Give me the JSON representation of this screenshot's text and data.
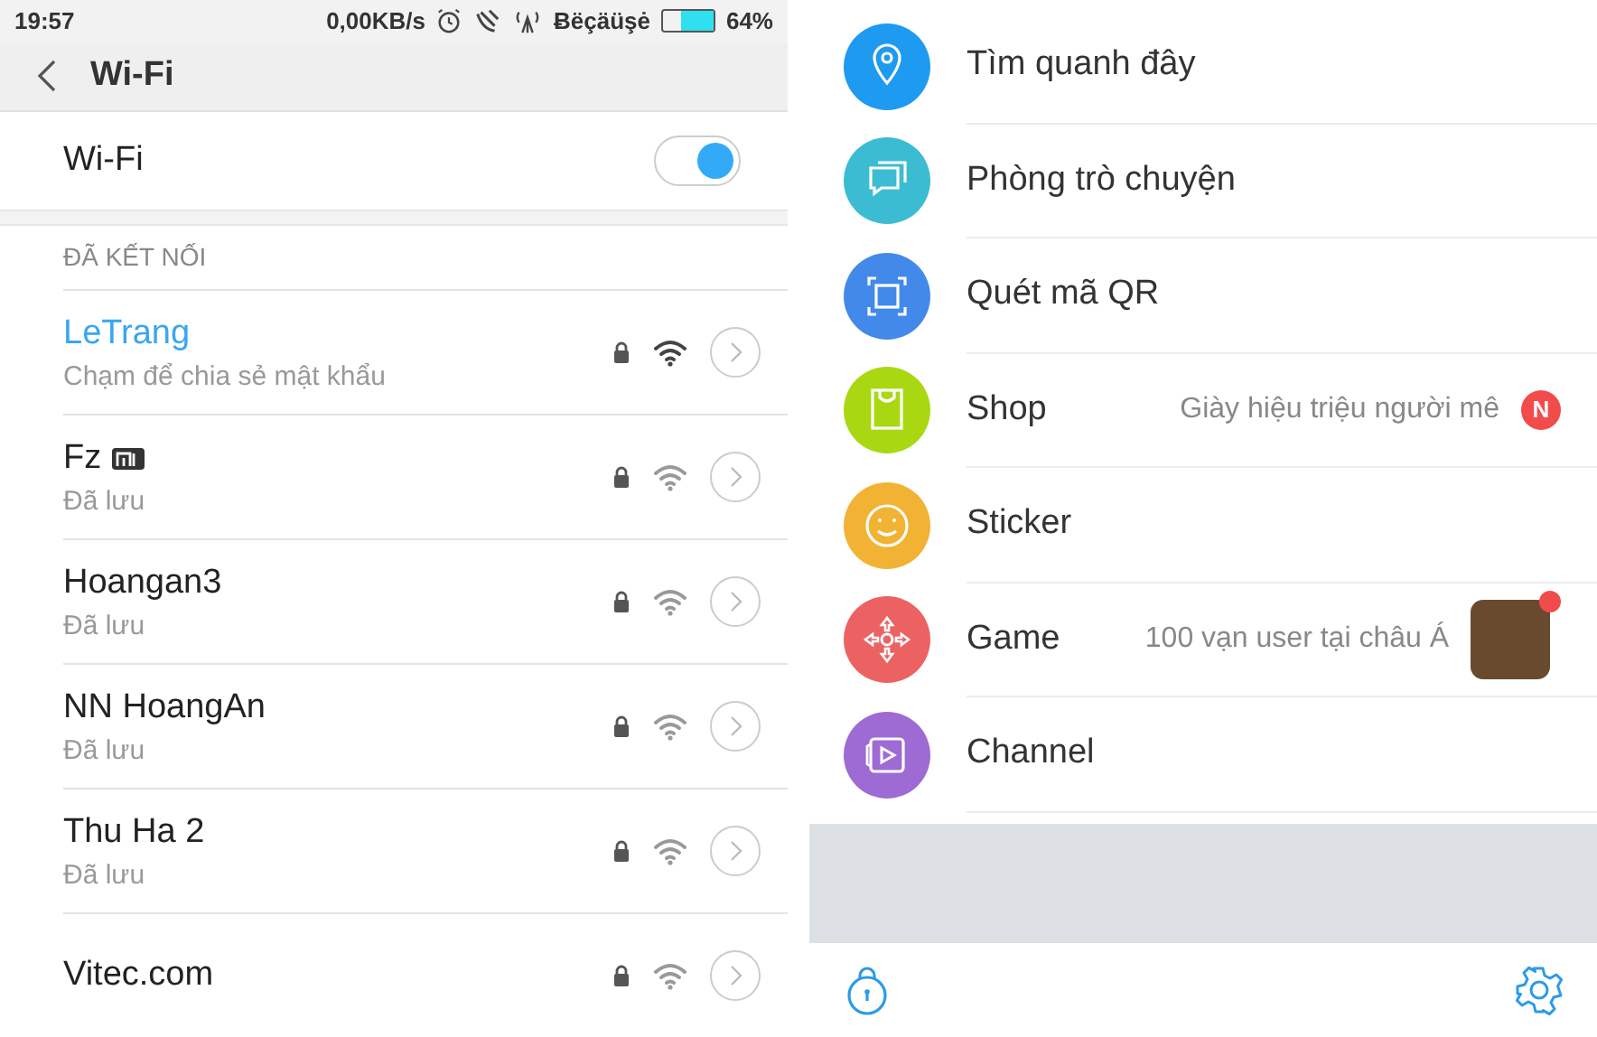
{
  "status_bar": {
    "time": "19:57",
    "speed": "0,00KB/s",
    "carrier": "Ƀëçäüşė",
    "battery": {
      "level": 0.64,
      "text": "64%"
    }
  },
  "header": {
    "title": "Wi-Fi"
  },
  "wifi_toggle": {
    "label": "Wi-Fi",
    "on": true
  },
  "section": {
    "title": "ĐÃ KẾT NỐI"
  },
  "networks": [
    {
      "name": "LeTrang",
      "subtitle": "Chạm để chia sẻ mật khẩu",
      "connected": true
    },
    {
      "name": "Fz",
      "subtitle": "Đã lưu",
      "connected": false,
      "mi_badge": true
    },
    {
      "name": "Hoangan3",
      "subtitle": "Đã lưu",
      "connected": false
    },
    {
      "name": "NN HoangAn",
      "subtitle": "Đã lưu",
      "connected": false
    },
    {
      "name": "Thu Ha 2",
      "subtitle": "Đã lưu",
      "connected": false
    },
    {
      "name": "Vitec.com",
      "connected": false
    }
  ],
  "menu": [
    {
      "kind": "pin",
      "label": "Tìm quanh đây",
      "color": "#1e9af0"
    },
    {
      "kind": "chat",
      "label": "Phòng trò chuyện",
      "color": "#3cbcd2"
    },
    {
      "kind": "qr",
      "label": "Quét mã QR",
      "color": "#4289ea"
    },
    {
      "kind": "shop",
      "label": "Shop",
      "color": "#a9d813",
      "hint": "Giày hiệu triệu người mê",
      "badge": "N"
    },
    {
      "kind": "sticker",
      "label": "Sticker",
      "color": "#f2b233"
    },
    {
      "kind": "game",
      "label": "Game",
      "color": "#ec6262",
      "hint": "100 vạn user tại châu Á",
      "thumbnail": true
    },
    {
      "kind": "channel",
      "label": "Channel",
      "color": "#9d6bd3"
    }
  ]
}
